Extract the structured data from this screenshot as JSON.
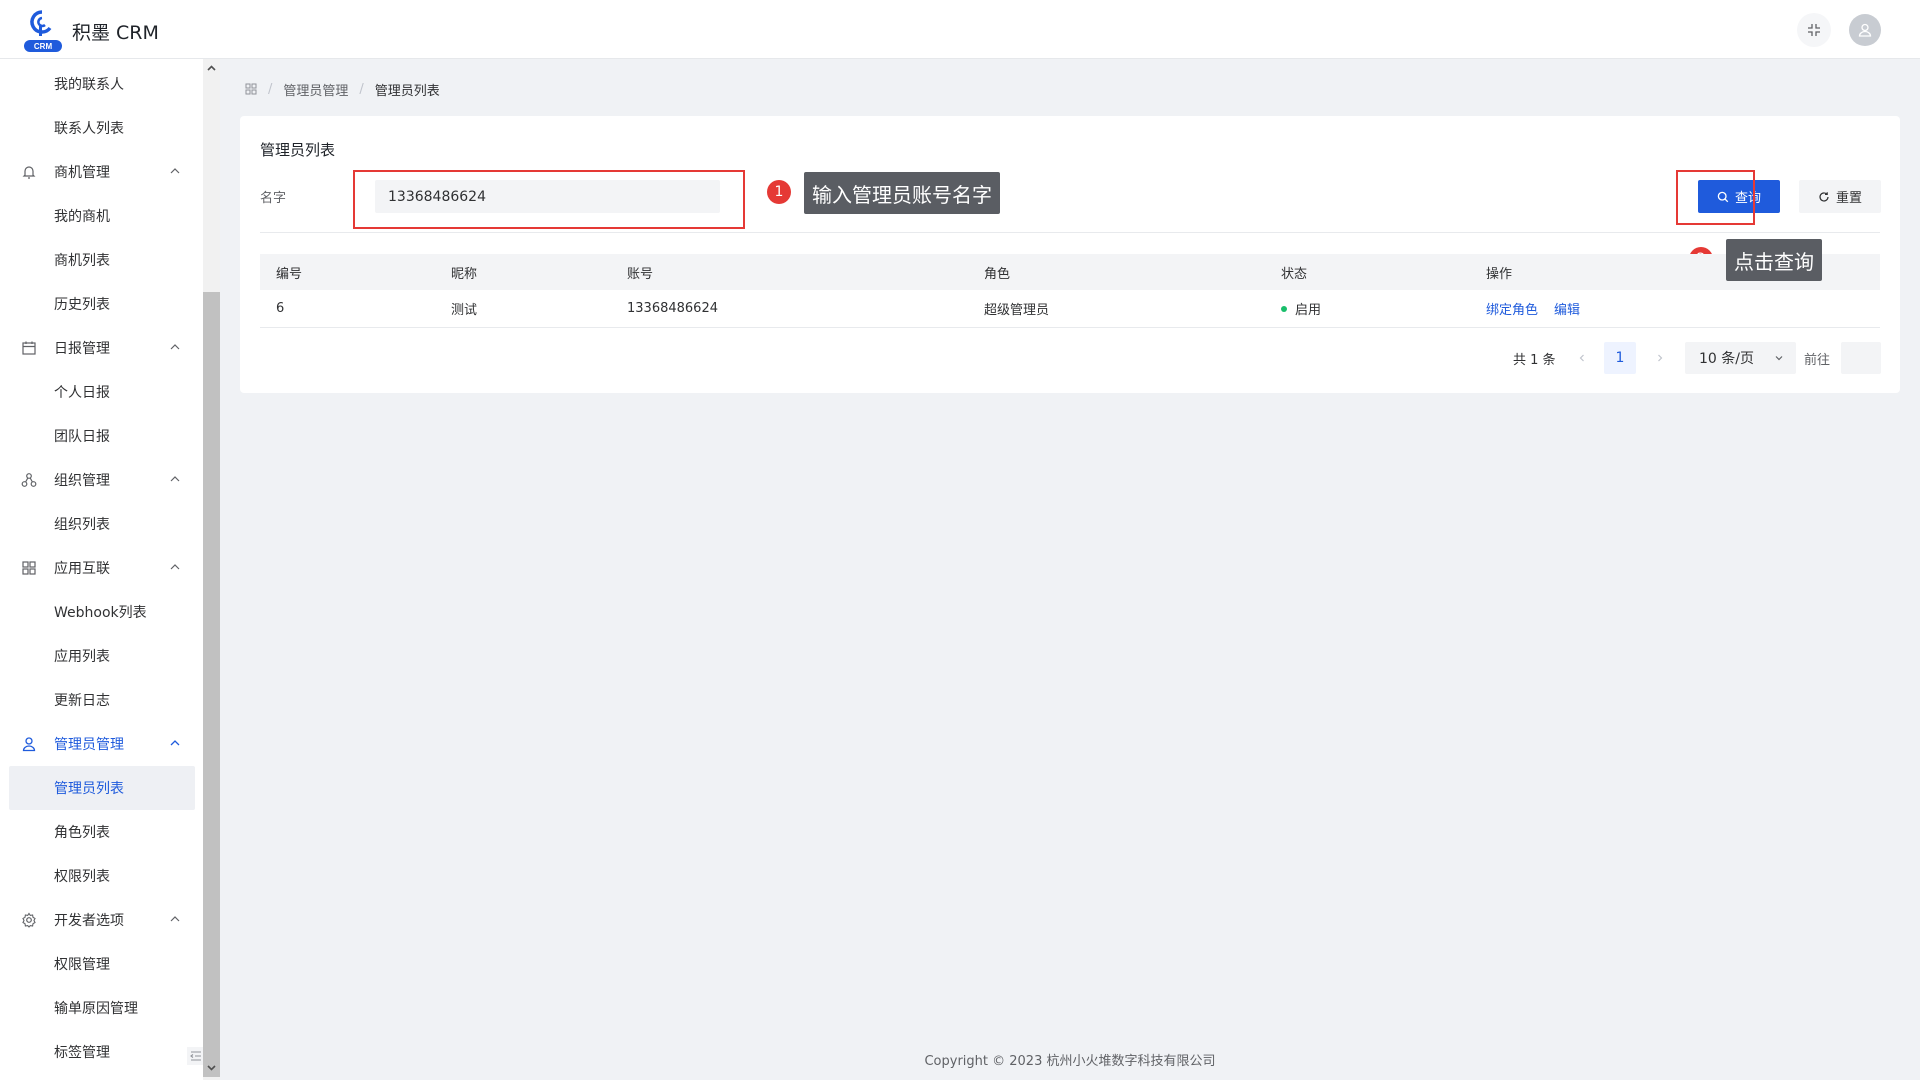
{
  "app": {
    "name": "积墨 CRM",
    "logo_text": "CRM"
  },
  "sidebar": {
    "items": [
      {
        "type": "sub",
        "label": "我的联系人"
      },
      {
        "type": "sub",
        "label": "联系人列表"
      },
      {
        "type": "group",
        "label": "商机管理",
        "icon": "bell-icon"
      },
      {
        "type": "sub",
        "label": "我的商机"
      },
      {
        "type": "sub",
        "label": "商机列表"
      },
      {
        "type": "sub",
        "label": "历史列表"
      },
      {
        "type": "group",
        "label": "日报管理",
        "icon": "calendar-icon"
      },
      {
        "type": "sub",
        "label": "个人日报"
      },
      {
        "type": "sub",
        "label": "团队日报"
      },
      {
        "type": "group",
        "label": "组织管理",
        "icon": "organization-icon"
      },
      {
        "type": "sub",
        "label": "组织列表"
      },
      {
        "type": "group",
        "label": "应用互联",
        "icon": "apps-grid-icon"
      },
      {
        "type": "sub",
        "label": "Webhook列表"
      },
      {
        "type": "sub",
        "label": "应用列表"
      },
      {
        "type": "sub",
        "label": "更新日志"
      },
      {
        "type": "group",
        "label": "管理员管理",
        "icon": "user-icon",
        "active": true
      },
      {
        "type": "sub",
        "label": "管理员列表",
        "active": true
      },
      {
        "type": "sub",
        "label": "角色列表"
      },
      {
        "type": "sub",
        "label": "权限列表"
      },
      {
        "type": "group",
        "label": "开发者选项",
        "icon": "gear-icon"
      },
      {
        "type": "sub",
        "label": "权限管理"
      },
      {
        "type": "sub",
        "label": "输单原因管理"
      },
      {
        "type": "sub",
        "label": "标签管理"
      }
    ]
  },
  "breadcrumb": {
    "items": [
      "管理员管理",
      "管理员列表"
    ]
  },
  "page": {
    "title": "管理员列表",
    "filter_label": "名字",
    "filter_value": "13368486624",
    "query_label": "查询",
    "reset_label": "重置"
  },
  "annotations": [
    {
      "num": "1",
      "text": "输入管理员账号名字"
    },
    {
      "num": "2",
      "text": "点击查询"
    }
  ],
  "table": {
    "columns": [
      "编号",
      "昵称",
      "账号",
      "角色",
      "状态",
      "操作"
    ],
    "rows": [
      {
        "id": "6",
        "nickname": "测试",
        "account": "13368486624",
        "role": "超级管理员",
        "status": "启用",
        "actions": [
          "绑定角色",
          "编辑"
        ]
      }
    ]
  },
  "pagination": {
    "total": "共 1 条",
    "current_page": "1",
    "page_size": "10 条/页",
    "jump_label": "前往"
  },
  "footer": {
    "text": "Copyright © 2023 杭州小火堆数字科技有限公司"
  },
  "colors": {
    "primary": "#1f5bdc",
    "annotation_red": "#e53935",
    "status_green": "#19be6b"
  }
}
